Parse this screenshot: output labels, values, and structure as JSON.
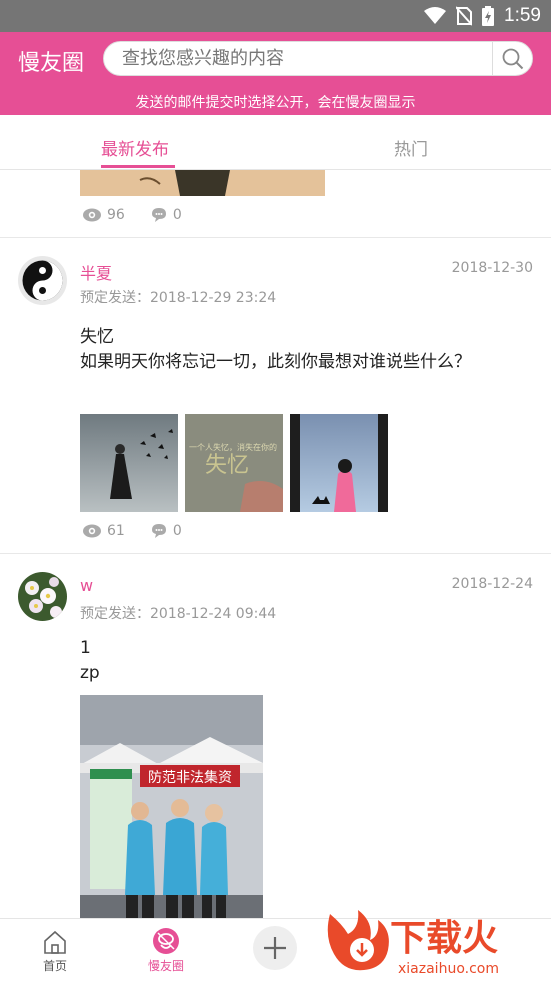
{
  "status_bar": {
    "time": "1:59",
    "icons": [
      "wifi-icon",
      "no-sim-icon",
      "battery-icon"
    ]
  },
  "header": {
    "brand": "慢友圈",
    "search_placeholder": "查找您感兴趣的内容",
    "notice": "发送的邮件提交时选择公开，会在慢友圈显示"
  },
  "tabs": [
    {
      "label": "最新发布",
      "active": true
    },
    {
      "label": "热门",
      "active": false
    }
  ],
  "colors": {
    "accent": "#e64f95",
    "status_bar": "#757575",
    "muted": "#999999"
  },
  "posts": [
    {
      "views": "96",
      "comments": "0"
    },
    {
      "username": "半夏",
      "date": "2018-12-30",
      "schedule": "预定发送：2018-12-29 23:24",
      "lines": [
        "失忆",
        "如果明天你将忘记一切，此刻你最想对谁说些什么？"
      ],
      "thumb_text": [
        "失忆",
        "一个人失忆，消失在你的"
      ],
      "views": "61",
      "comments": "0"
    },
    {
      "username": "w",
      "date": "2018-12-24",
      "schedule": "预定发送：2018-12-24 09:44",
      "lines": [
        "1",
        "zp"
      ],
      "banner_text": "防范非法集资"
    }
  ],
  "bottom_nav": [
    {
      "label": "首页",
      "icon": "home-icon",
      "active": false
    },
    {
      "label": "慢友圈",
      "icon": "friends-circle-icon",
      "active": true
    },
    {
      "label": "",
      "icon": "plus-icon",
      "active": false
    }
  ],
  "watermark": {
    "title": "下载火",
    "url": "xiazaihuo.com"
  }
}
